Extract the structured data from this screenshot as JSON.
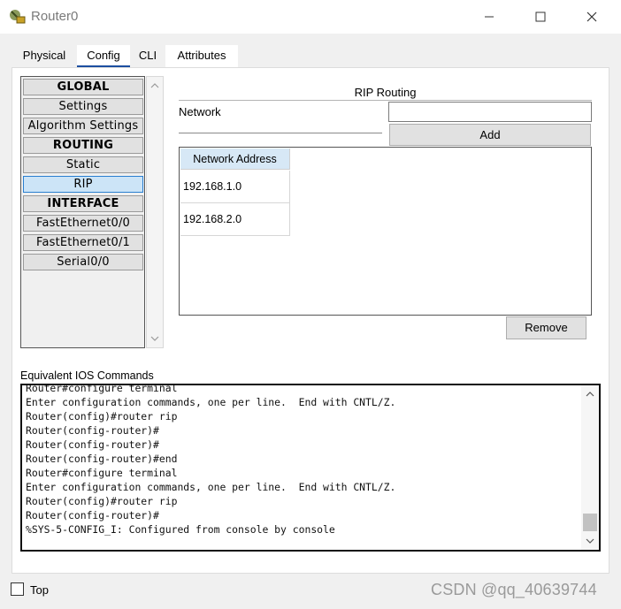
{
  "window": {
    "title": "Router0",
    "minimize_icon": "minimize-icon",
    "maximize_icon": "maximize-icon",
    "close_icon": "close-icon"
  },
  "tabs": [
    {
      "label": "Physical"
    },
    {
      "label": "Config",
      "selected": true
    },
    {
      "label": "CLI"
    },
    {
      "label": "Attributes"
    }
  ],
  "sidebar": {
    "items": [
      {
        "label": "GLOBAL",
        "header": true
      },
      {
        "label": "Settings"
      },
      {
        "label": "Algorithm Settings"
      },
      {
        "label": "ROUTING",
        "header": true
      },
      {
        "label": "Static"
      },
      {
        "label": "RIP",
        "selected": true
      },
      {
        "label": "INTERFACE",
        "header": true
      },
      {
        "label": "FastEthernet0/0"
      },
      {
        "label": "FastEthernet0/1"
      },
      {
        "label": "Serial0/0"
      }
    ]
  },
  "rip": {
    "title": "RIP Routing",
    "network_label": "Network",
    "network_value": "",
    "add_label": "Add",
    "remove_label": "Remove",
    "table_header": "Network Address",
    "rows": [
      "192.168.1.0",
      "192.168.2.0"
    ]
  },
  "ios": {
    "label": "Equivalent IOS Commands",
    "lines": [
      "Router#configure terminal",
      "Enter configuration commands, one per line.  End with CNTL/Z.",
      "Router(config)#router rip",
      "Router(config-router)#",
      "Router(config-router)#",
      "Router(config-router)#end",
      "Router#configure terminal",
      "Enter configuration commands, one per line.  End with CNTL/Z.",
      "Router(config)#router rip",
      "Router(config-router)#",
      "%SYS-5-CONFIG_I: Configured from console by console"
    ]
  },
  "footer": {
    "top_label": "Top",
    "top_checked": false,
    "watermark": "CSDN @qq_40639744"
  },
  "colors": {
    "selected_item_bg": "#cce4f7",
    "tab_underline": "#1c4fa0",
    "table_header_bg": "#d7e8f6"
  }
}
